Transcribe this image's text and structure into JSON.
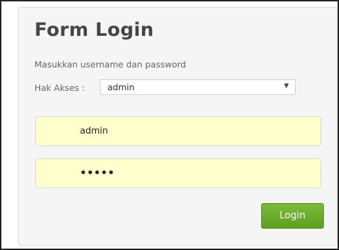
{
  "form": {
    "title": "Form Login",
    "subtitle": "Masukkan username dan password",
    "access_label": "Hak Akses :",
    "access_selected": "admin",
    "select_arrow_icon": "triangle-down-icon",
    "username_value": "admin",
    "password_value": "•••••",
    "login_label": "Login"
  },
  "colors": {
    "field_background": "#ffffcc",
    "button_green": "#6aab2c",
    "title_color": "#454545"
  }
}
